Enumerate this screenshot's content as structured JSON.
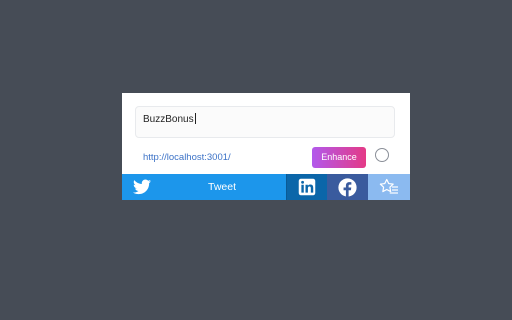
{
  "popup": {
    "text_value": "BuzzBonus",
    "url": "http://localhost:3001/",
    "enhance_label": "Enhance"
  },
  "share": {
    "tweet_label": "Tweet",
    "icons": [
      "twitter-icon",
      "linkedin-icon",
      "facebook-icon",
      "star-list-icon"
    ]
  },
  "colors": {
    "background": "#464c56",
    "twitter": "#1c96eb",
    "linkedin": "#0b66a9",
    "facebook": "#3a5b9e",
    "favorite": "#8bbaf0",
    "enhance_start": "#b259ec",
    "enhance_end": "#e43a86",
    "link": "#3d73c7"
  }
}
